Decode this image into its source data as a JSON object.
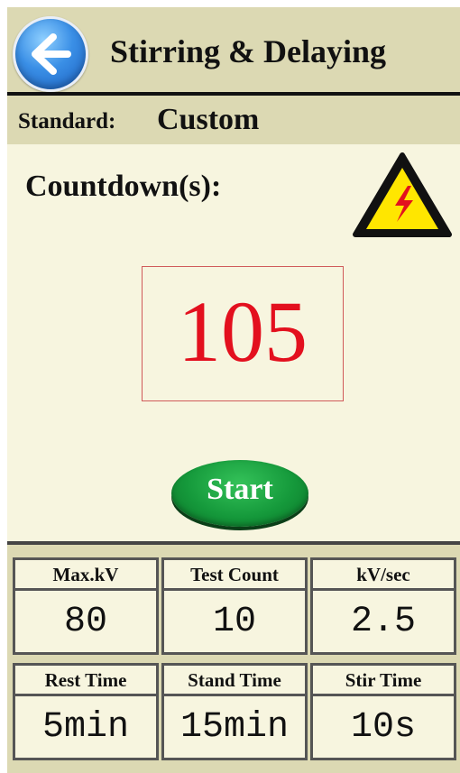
{
  "header": {
    "title": "Stirring & Delaying",
    "back_icon": "back-arrow-icon"
  },
  "standard": {
    "label": "Standard:",
    "value": "Custom"
  },
  "countdown": {
    "label": "Countdown(s):",
    "value": "105"
  },
  "warning": {
    "icon": "high-voltage-warning-icon"
  },
  "actions": {
    "start_label": "Start"
  },
  "params": {
    "max_kv": {
      "label": "Max.kV",
      "value": "80"
    },
    "test_count": {
      "label": "Test Count",
      "value": "10"
    },
    "kv_per_sec": {
      "label": "kV/sec",
      "value": "2.5"
    },
    "rest_time": {
      "label": "Rest Time",
      "value": "5min"
    },
    "stand_time": {
      "label": "Stand Time",
      "value": "15min"
    },
    "stir_time": {
      "label": "Stir Time",
      "value": "10s"
    }
  },
  "colors": {
    "countdown": "#e3101e",
    "start_button": "#15993b",
    "back_button": "#3a8fe6",
    "header_bg": "#dcd9b3",
    "body_bg": "#f7f5df"
  }
}
